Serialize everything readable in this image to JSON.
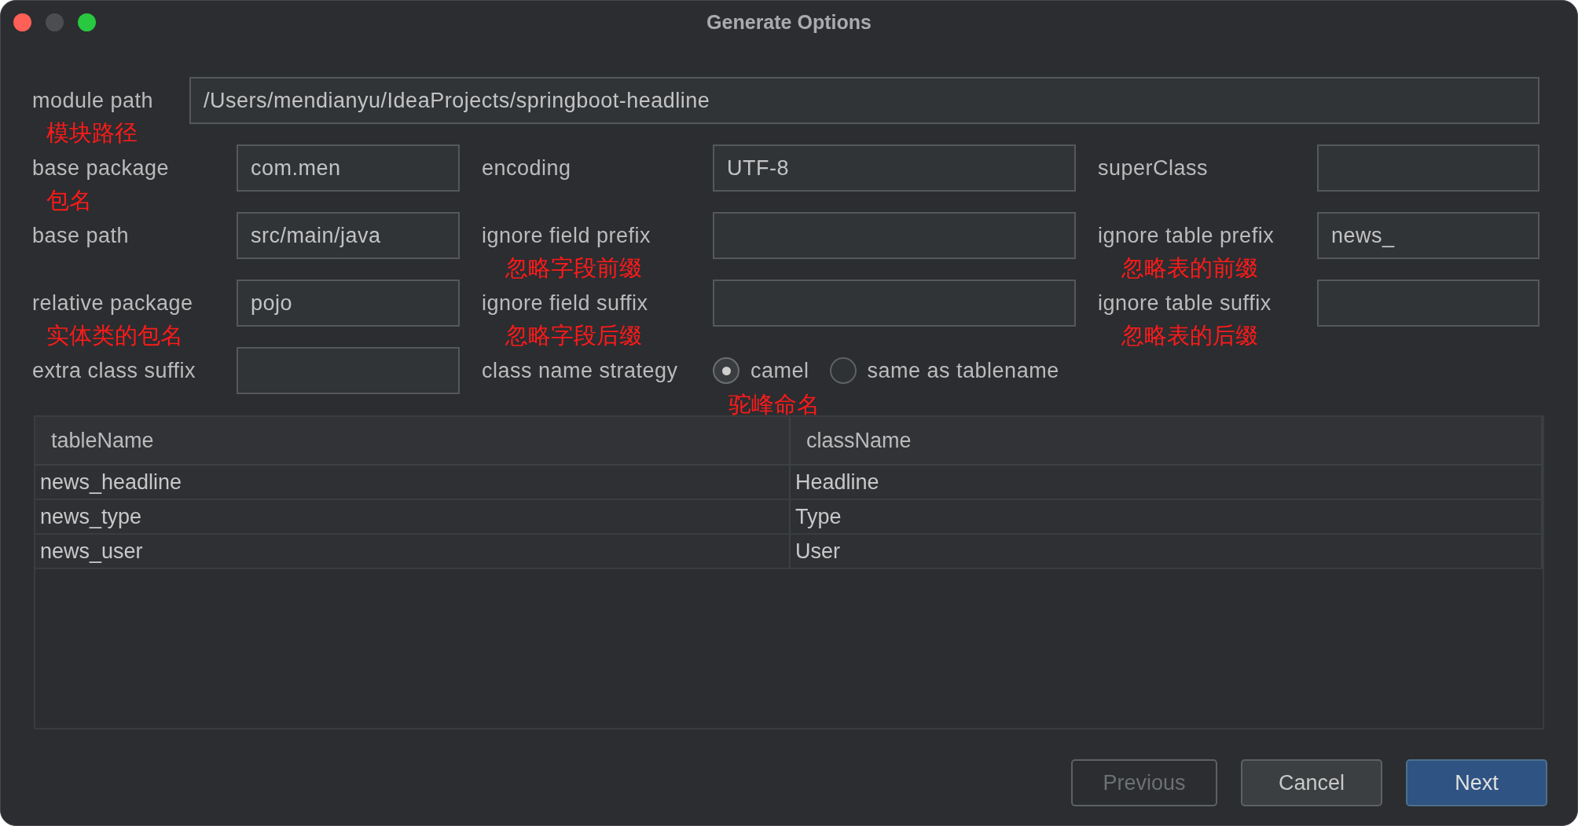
{
  "window": {
    "title": "Generate Options"
  },
  "module_path": {
    "label": "module path",
    "value": "/Users/mendianyu/IdeaProjects/springboot-headline",
    "note": "模块路径"
  },
  "rows": [
    {
      "cells": [
        {
          "kind": "text",
          "label": "base package",
          "value": "com.men",
          "note": "包名"
        },
        {
          "kind": "text",
          "label": "encoding",
          "value": "UTF-8"
        },
        {
          "kind": "text",
          "label": "superClass"
        }
      ]
    },
    {
      "cells": [
        {
          "kind": "text",
          "label": "base path",
          "value": "src/main/java"
        },
        {
          "kind": "text",
          "label": "ignore field prefix",
          "note": "忽略字段前缀"
        },
        {
          "kind": "text",
          "label": "ignore table prefix",
          "value": "news_",
          "note": "忽略表的前缀"
        }
      ]
    },
    {
      "cells": [
        {
          "kind": "text",
          "label": "relative package",
          "value": "pojo",
          "note": "实体类的包名"
        },
        {
          "kind": "text",
          "label": "ignore field suffix",
          "note": "忽略字段后缀"
        },
        {
          "kind": "text",
          "label": "ignore table suffix",
          "note": "忽略表的后缀"
        }
      ]
    },
    {
      "cells": [
        {
          "kind": "text",
          "label": "extra class suffix"
        },
        {
          "kind": "radio",
          "label": "class name strategy",
          "options": [
            {
              "label": "camel",
              "selected": true,
              "note": "驼峰命名"
            },
            {
              "label": "same as tablename",
              "selected": false
            }
          ]
        }
      ]
    }
  ],
  "table": {
    "columns": [
      "tableName",
      "className"
    ],
    "rows": [
      [
        "news_headline",
        "Headline"
      ],
      [
        "news_type",
        "Type"
      ],
      [
        "news_user",
        "User"
      ]
    ]
  },
  "buttons": [
    {
      "label": "Previous",
      "kind": "secondary",
      "disabled": true
    },
    {
      "label": "Cancel",
      "kind": "secondary",
      "disabled": false
    },
    {
      "label": "Next",
      "kind": "primary",
      "disabled": false
    }
  ]
}
